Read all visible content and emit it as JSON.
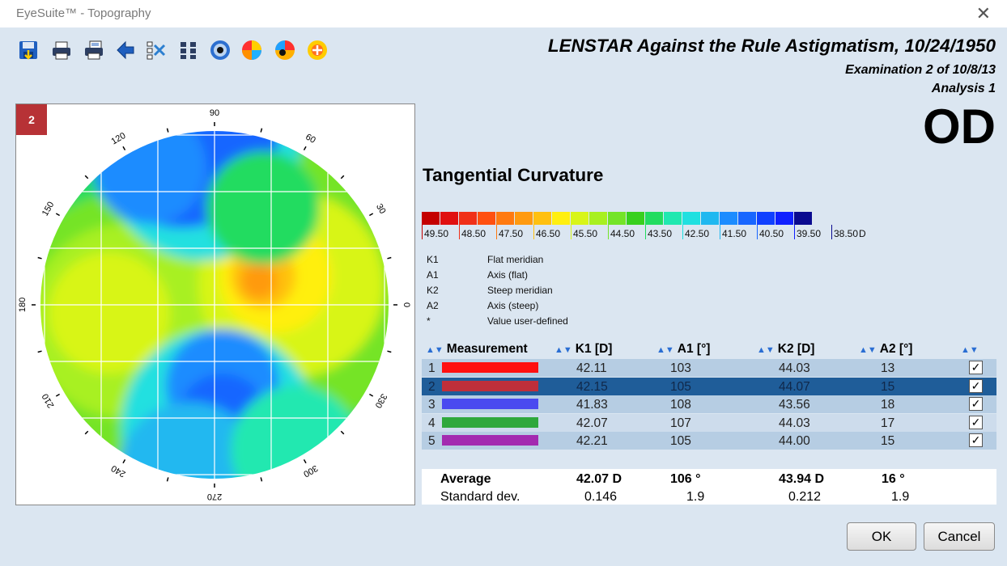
{
  "window": {
    "title": "EyeSuite™ - Topography"
  },
  "header": {
    "title": "LENSTAR Against the Rule Astigmatism,  10/24/1950",
    "examination": "Examination 2 of 10/8/13",
    "analysis": "Analysis 1",
    "eye": "OD"
  },
  "map": {
    "badge": "2",
    "map_type": "Tangential Curvature",
    "axis_labels": [
      "0",
      "30",
      "60",
      "90",
      "120",
      "150",
      "180",
      "210",
      "240",
      "270",
      "300",
      "330"
    ]
  },
  "scale": {
    "colors": [
      "#c40000",
      "#e01010",
      "#f03018",
      "#ff5010",
      "#ff7a10",
      "#ff9a10",
      "#ffc010",
      "#ffef10",
      "#d8f518",
      "#a8f020",
      "#74e428",
      "#38d01e",
      "#22dc60",
      "#20e8b0",
      "#20e0e0",
      "#20b8f0",
      "#1c8cff",
      "#1866ff",
      "#1040ff",
      "#1020ff",
      "#0a0a90"
    ],
    "labels": [
      "49.50",
      "48.50",
      "47.50",
      "46.50",
      "45.50",
      "44.50",
      "43.50",
      "42.50",
      "41.50",
      "40.50",
      "39.50",
      "38.50"
    ],
    "label_colors": [
      "#c40000",
      "#f03018",
      "#ff7a10",
      "#ffc010",
      "#d8f518",
      "#74e428",
      "#22dc60",
      "#20e0e0",
      "#20b8f0",
      "#1866ff",
      "#1020ff",
      "#0a0a90"
    ],
    "unit": "D"
  },
  "legend": [
    {
      "abbr": "K1",
      "desc": "Flat meridian"
    },
    {
      "abbr": "A1",
      "desc": "Axis (flat)"
    },
    {
      "abbr": "K2",
      "desc": "Steep meridian"
    },
    {
      "abbr": "A2",
      "desc": "Axis (steep)"
    },
    {
      "abbr": "*",
      "desc": "Value user-defined"
    }
  ],
  "table": {
    "headers": {
      "measurement": "Measurement",
      "k1": "K1 [D]",
      "a1": "A1 [°]",
      "k2": "K2 [D]",
      "a2": "A2 [°]"
    },
    "rows": [
      {
        "n": "1",
        "color": "#ff1010",
        "k1": "42.11",
        "a1": "103",
        "k2": "44.03",
        "a2": "13",
        "checked": true,
        "selected": false
      },
      {
        "n": "2",
        "color": "#bf2f3a",
        "k1": "42.15",
        "a1": "105",
        "k2": "44.07",
        "a2": "15",
        "checked": true,
        "selected": true
      },
      {
        "n": "3",
        "color": "#4a4af0",
        "k1": "41.83",
        "a1": "108",
        "k2": "43.56",
        "a2": "18",
        "checked": true,
        "selected": false
      },
      {
        "n": "4",
        "color": "#2fa83c",
        "k1": "42.07",
        "a1": "107",
        "k2": "44.03",
        "a2": "17",
        "checked": true,
        "selected": false
      },
      {
        "n": "5",
        "color": "#a32ab0",
        "k1": "42.21",
        "a1": "105",
        "k2": "44.00",
        "a2": "15",
        "checked": true,
        "selected": false
      }
    ],
    "average": {
      "label": "Average",
      "k1": "42.07 D",
      "a1": "106 °",
      "k2": "43.94 D",
      "a2": "16 °"
    },
    "std": {
      "label": "Standard dev.",
      "k1": "0.146",
      "a1": "1.9",
      "k2": "0.212",
      "a2": "1.9"
    }
  },
  "buttons": {
    "ok": "OK",
    "cancel": "Cancel"
  },
  "toolbar": [
    {
      "name": "save-icon"
    },
    {
      "name": "print-icon"
    },
    {
      "name": "print-preview-icon"
    },
    {
      "name": "back-icon"
    },
    {
      "name": "compare-icon"
    },
    {
      "name": "grid-icon"
    },
    {
      "name": "eye-image-icon"
    },
    {
      "name": "topography-map-icon"
    },
    {
      "name": "keratometry-icon"
    },
    {
      "name": "analysis-icon"
    }
  ]
}
